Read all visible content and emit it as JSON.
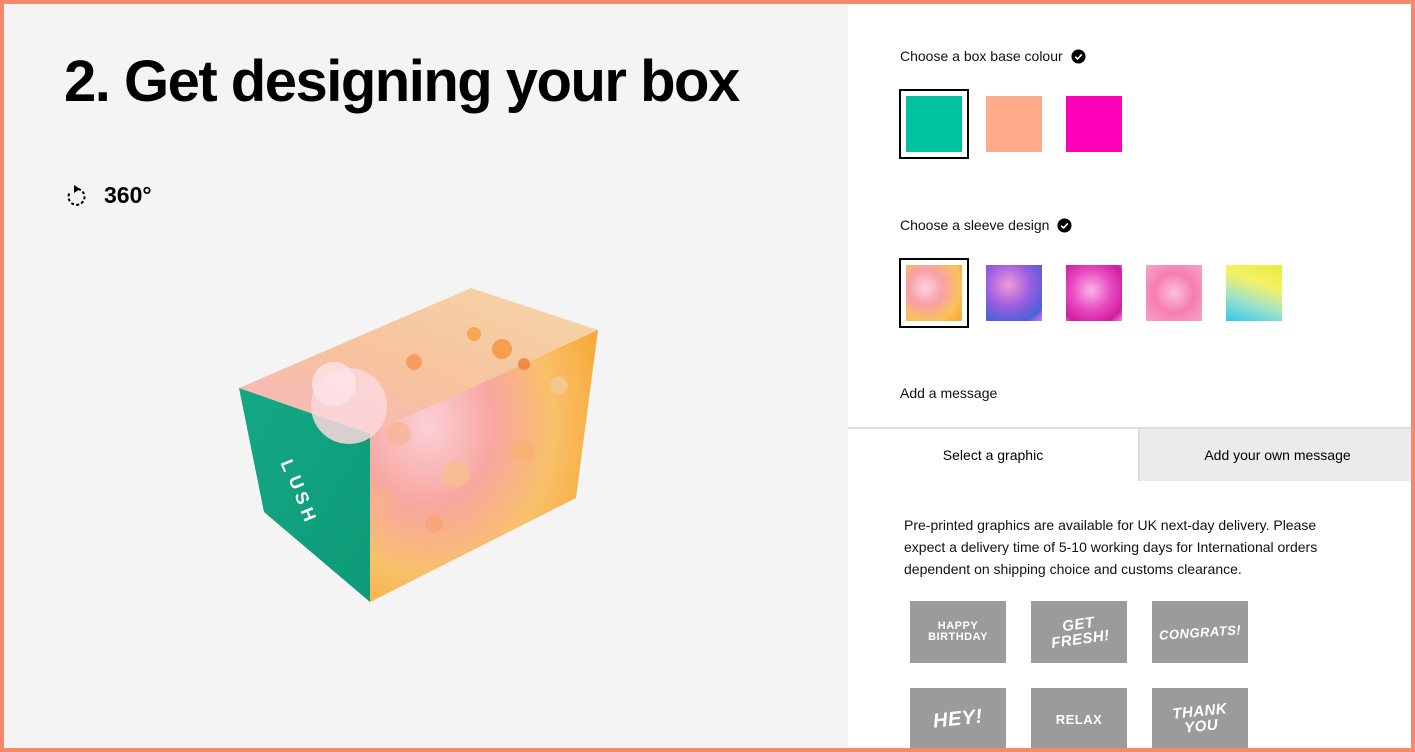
{
  "page": {
    "title": "2. Get designing your box",
    "rotate_label": "360°"
  },
  "box_base": {
    "label": "Choose a box base colour",
    "colors": [
      "#00c2a0",
      "#ffab8c",
      "#ff00bb"
    ],
    "selected_index": 0
  },
  "sleeve": {
    "label": "Choose a sleeve design",
    "designs": [
      "orange-pink bubbles",
      "purple-blue bubbles",
      "magenta bubbles",
      "pink speckle",
      "yellow-cyan"
    ],
    "selected_index": 0
  },
  "message": {
    "label": "Add a message",
    "tabs": [
      "Select a graphic",
      "Add your own message"
    ],
    "active_tab": 0,
    "info": "Pre-printed graphics are available for UK next-day delivery. Please expect a delivery time of 5-10 working days for International orders dependent on shipping choice and customs clearance.",
    "graphics": [
      "HAPPY\nBIRTHDAY",
      "GET\nFRESH!",
      "CONGRATS!",
      "HEY!",
      "RELAX",
      "THANK\nYOU"
    ]
  },
  "box_logo": "LUSH"
}
